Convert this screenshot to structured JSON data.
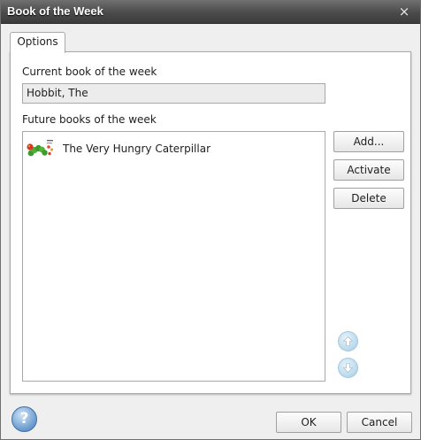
{
  "window": {
    "title": "Book of the Week",
    "close_glyph": "×"
  },
  "tabs": [
    {
      "label": "Options"
    }
  ],
  "current": {
    "label": "Current book of the week",
    "value": "Hobbit, The"
  },
  "future": {
    "label": "Future books of the week",
    "items": [
      {
        "title": "The Very Hungry Caterpillar",
        "icon": "book-cover-thumbnail"
      }
    ]
  },
  "actions": {
    "add": "Add...",
    "activate": "Activate",
    "delete": "Delete"
  },
  "move": {
    "up_icon": "arrow-up-icon",
    "down_icon": "arrow-down-icon"
  },
  "footer": {
    "help_glyph": "?",
    "ok": "OK",
    "cancel": "Cancel"
  }
}
